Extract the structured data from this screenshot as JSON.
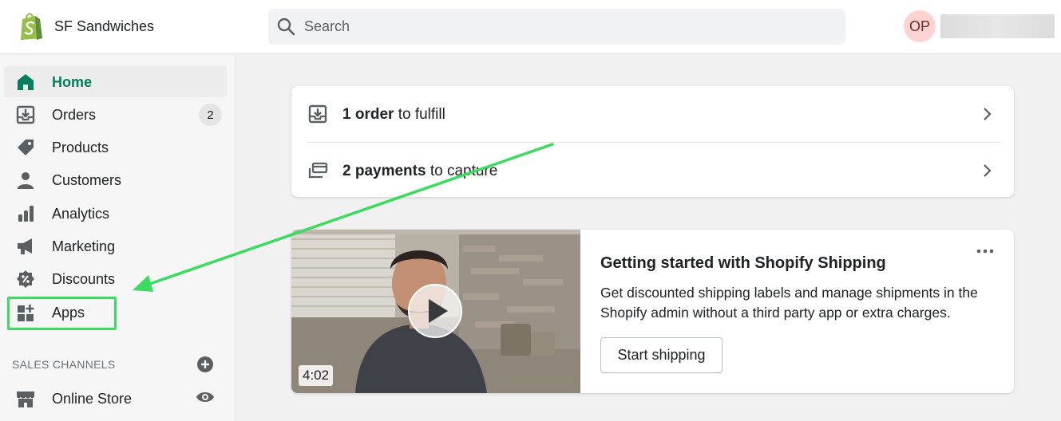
{
  "header": {
    "store_name": "SF Sandwiches",
    "search_placeholder": "Search",
    "avatar_initials": "OP"
  },
  "sidebar": {
    "items": [
      {
        "label": "Home",
        "icon": "home-icon",
        "active": true
      },
      {
        "label": "Orders",
        "icon": "orders-icon",
        "badge": "2"
      },
      {
        "label": "Products",
        "icon": "tag-icon"
      },
      {
        "label": "Customers",
        "icon": "person-icon"
      },
      {
        "label": "Analytics",
        "icon": "bar-chart-icon"
      },
      {
        "label": "Marketing",
        "icon": "megaphone-icon"
      },
      {
        "label": "Discounts",
        "icon": "discount-icon"
      },
      {
        "label": "Apps",
        "icon": "apps-icon"
      }
    ],
    "sales_channels_title": "SALES CHANNELS",
    "channels": [
      {
        "label": "Online Store",
        "icon": "store-icon"
      }
    ]
  },
  "tasks": [
    {
      "bold": "1 order",
      "rest": " to fulfill",
      "icon": "fulfill-icon"
    },
    {
      "bold": "2 payments",
      "rest": " to capture",
      "icon": "payment-icon"
    }
  ],
  "shipping_card": {
    "video_duration": "4:02",
    "title": "Getting started with Shopify Shipping",
    "description": "Get discounted shipping labels and manage shipments in the Shopify admin without a third party app or extra charges.",
    "button_label": "Start shipping"
  },
  "colors": {
    "accent_green": "#007f5f",
    "annotation_green": "#3bdb5f",
    "avatar_bg": "#fed3d1",
    "logo_green": "#95bf47"
  }
}
